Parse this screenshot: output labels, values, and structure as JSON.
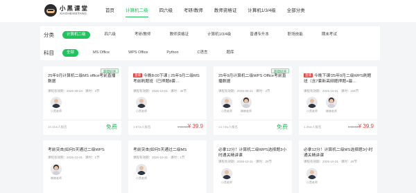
{
  "header": {
    "brand_cn": "小黑课堂",
    "brand_en": "XIAOHEIKETANG",
    "nav": [
      "首页",
      "计算机二级",
      "四六级",
      "考研/教师",
      "教师资格证",
      "计算机1/3/4级",
      "全部分类"
    ]
  },
  "filters": {
    "category_label": "分类",
    "categories": [
      "计算机二级",
      "四六级",
      "考研/教师",
      "教师资格证",
      "计算机1/3/4级",
      "普通专升本",
      "职场技能",
      "期末考试"
    ],
    "subject_label": "科目",
    "subjects": [
      "全部",
      "MS Office",
      "WPS Office",
      "Python",
      "C语言",
      "题库"
    ]
  },
  "courses": [
    {
      "title": "25年9月计算机二级MS office考前直播数据",
      "hot": "",
      "badge": "获得好评",
      "meta": "课程有效期：2025-09-24 · 课时：3节",
      "teachers": [
        {
          "name": "小黑老师",
          "female": false
        }
      ],
      "enrolled": "10.11w人报名",
      "price_free": "免费",
      "price_old": "",
      "price": ""
    },
    {
      "title": "今晚8:00下课 | 25年9月二级MS考前刷题班（已押题8套…",
      "hot": "直播",
      "badge": "",
      "meta": "课程有效期：2025-10-01 · 课时：45节",
      "teachers": [
        {
          "name": "小黑老师",
          "female": false
        }
      ],
      "enrolled": "1.67w人报名",
      "price_free": "",
      "price_old": "¥ 69.90",
      "price": "¥ 39.9"
    },
    {
      "title": "25年9月计算机二级WPS Office考前直播数据",
      "hot": "",
      "badge": "获得好评",
      "meta": "课程有效期：2025-09-21 · 课时：3节",
      "teachers": [
        {
          "name": "小黑老师",
          "female": false
        },
        {
          "name": "晓晓老师",
          "female": true
        }
      ],
      "enrolled": "14.74w人报名",
      "price_free": "免费",
      "price_old": "",
      "price": ""
    },
    {
      "title": "今晚下课!25年9月二级WPS刷题班（含7套新高频题押题+最…",
      "hot": "直播",
      "badge": "",
      "meta": "课程有效期：2025-10-01 · 课时：106节",
      "teachers": [
        {
          "name": "小黑老师",
          "female": false
        },
        {
          "name": "晓晓老师",
          "female": true
        }
      ],
      "enrolled": "1.35w人报名",
      "price_free": "",
      "price_old": "¥ 69.90",
      "price": "¥ 39.9"
    },
    {
      "title": "考前突击|如何5天通过二级WPS",
      "hot": "",
      "badge": "",
      "meta": "课程有效期：2026-10-31 · 课时：1节",
      "teachers": [
        {
          "name": "晓晓老师",
          "female": true
        }
      ],
      "enrolled": "",
      "price_free": "",
      "price_old": "",
      "price": ""
    },
    {
      "title": "考前突击|如何5天通过二级MS",
      "hot": "",
      "badge": "",
      "meta": "课程有效期：2026-10-31 · 课时：1节",
      "teachers": [
        {
          "name": "小黑老师",
          "female": false
        }
      ],
      "enrolled": "",
      "price_free": "",
      "price_old": "",
      "price": ""
    },
    {
      "title": "必拿12分！计算机二级WPS选择题3小时通关精讲课",
      "hot": "",
      "badge": "",
      "meta": "课程有效期：2026-10-31 · 课时：29节",
      "teachers": [
        {
          "name": "小黑老师",
          "female": false
        }
      ],
      "enrolled": "",
      "price_free": "",
      "price_old": "",
      "price": ""
    },
    {
      "title": "必拿12分！计算机二级MS选择题3小时通关精讲课",
      "hot": "",
      "badge": "",
      "meta": "课程有效期：2026-10-31 · 课时：29节",
      "teachers": [
        {
          "name": "小黑老师",
          "female": false
        }
      ],
      "enrolled": "",
      "price_free": "",
      "price_old": "",
      "price": ""
    }
  ]
}
